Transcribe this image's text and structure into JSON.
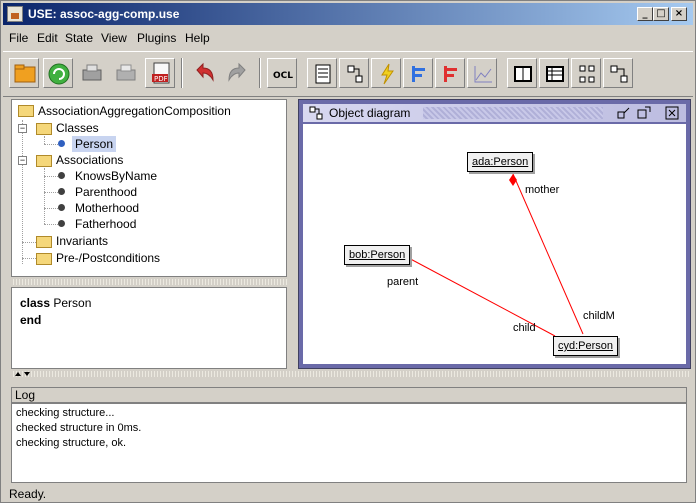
{
  "window": {
    "title": "USE: assoc-agg-comp.use",
    "app_icon": "java-cup-icon"
  },
  "title_buttons": {
    "minimize": "_",
    "maximize": "□",
    "close": "×"
  },
  "menu": [
    "File",
    "Edit",
    "State",
    "View",
    "Plugins",
    "Help"
  ],
  "toolbar": {
    "icons": [
      "open-folder-icon",
      "reload-icon",
      "print-icon",
      "print-view-icon",
      "export-pdf-icon",
      "undo-icon",
      "redo-icon",
      "ocl-evaluator-icon",
      "class-invariant-view-icon",
      "object-diagram-icon",
      "state-evolution-icon",
      "sequence-diagram-icon",
      "communication-diagram-icon",
      "line-chart-icon",
      "class-extent-icon",
      "object-properties-icon",
      "association-icon",
      "class-diagram-icon"
    ],
    "ocl_label": "OCL"
  },
  "tree": {
    "root": "AssociationAggregationComposition",
    "classes_label": "Classes",
    "classes": [
      "Person"
    ],
    "associations_label": "Associations",
    "associations": [
      "KnowsByName",
      "Parenthood",
      "Motherhood",
      "Fatherhood"
    ],
    "invariants_label": "Invariants",
    "prepost_label": "Pre-/Postconditions",
    "expander_minus": "−"
  },
  "details": {
    "keyword_class": "class",
    "class_name": "Person",
    "keyword_end": "end"
  },
  "diagram": {
    "title": "Object diagram",
    "objects": {
      "ada": "ada:Person",
      "bob": "bob:Person",
      "cyd": "cyd:Person"
    },
    "roles": {
      "mother": "mother",
      "parent": "parent",
      "child": "child",
      "childM": "childM"
    },
    "link_color": "#ff0000"
  },
  "log": {
    "title": "Log",
    "lines": [
      "checking structure...",
      "checked structure in 0ms.",
      "checking structure, ok."
    ]
  },
  "status": "Ready.",
  "colors": {
    "titlebar_start": "#0a246a",
    "titlebar_end": "#a6caf0",
    "diagram_frame": "#6a6aa8",
    "selection": "#c8d4f0"
  }
}
